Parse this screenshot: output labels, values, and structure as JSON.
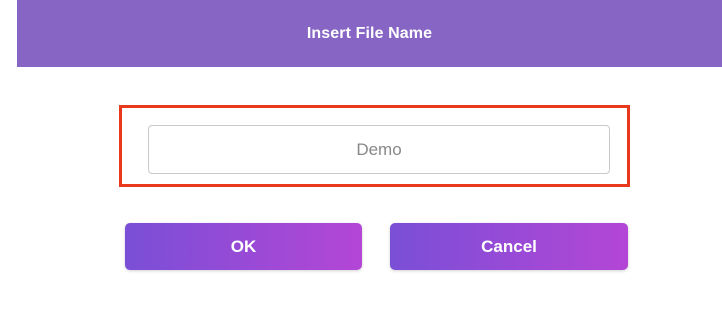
{
  "dialog": {
    "title": "Insert File Name",
    "input": {
      "value": "",
      "placeholder": "Demo"
    },
    "ok_label": "OK",
    "cancel_label": "Cancel"
  },
  "colors": {
    "header_bg": "#8665c4",
    "highlight_border": "#e8391d",
    "button_gradient_start": "#7a4fd6",
    "button_gradient_end": "#b446d6"
  }
}
